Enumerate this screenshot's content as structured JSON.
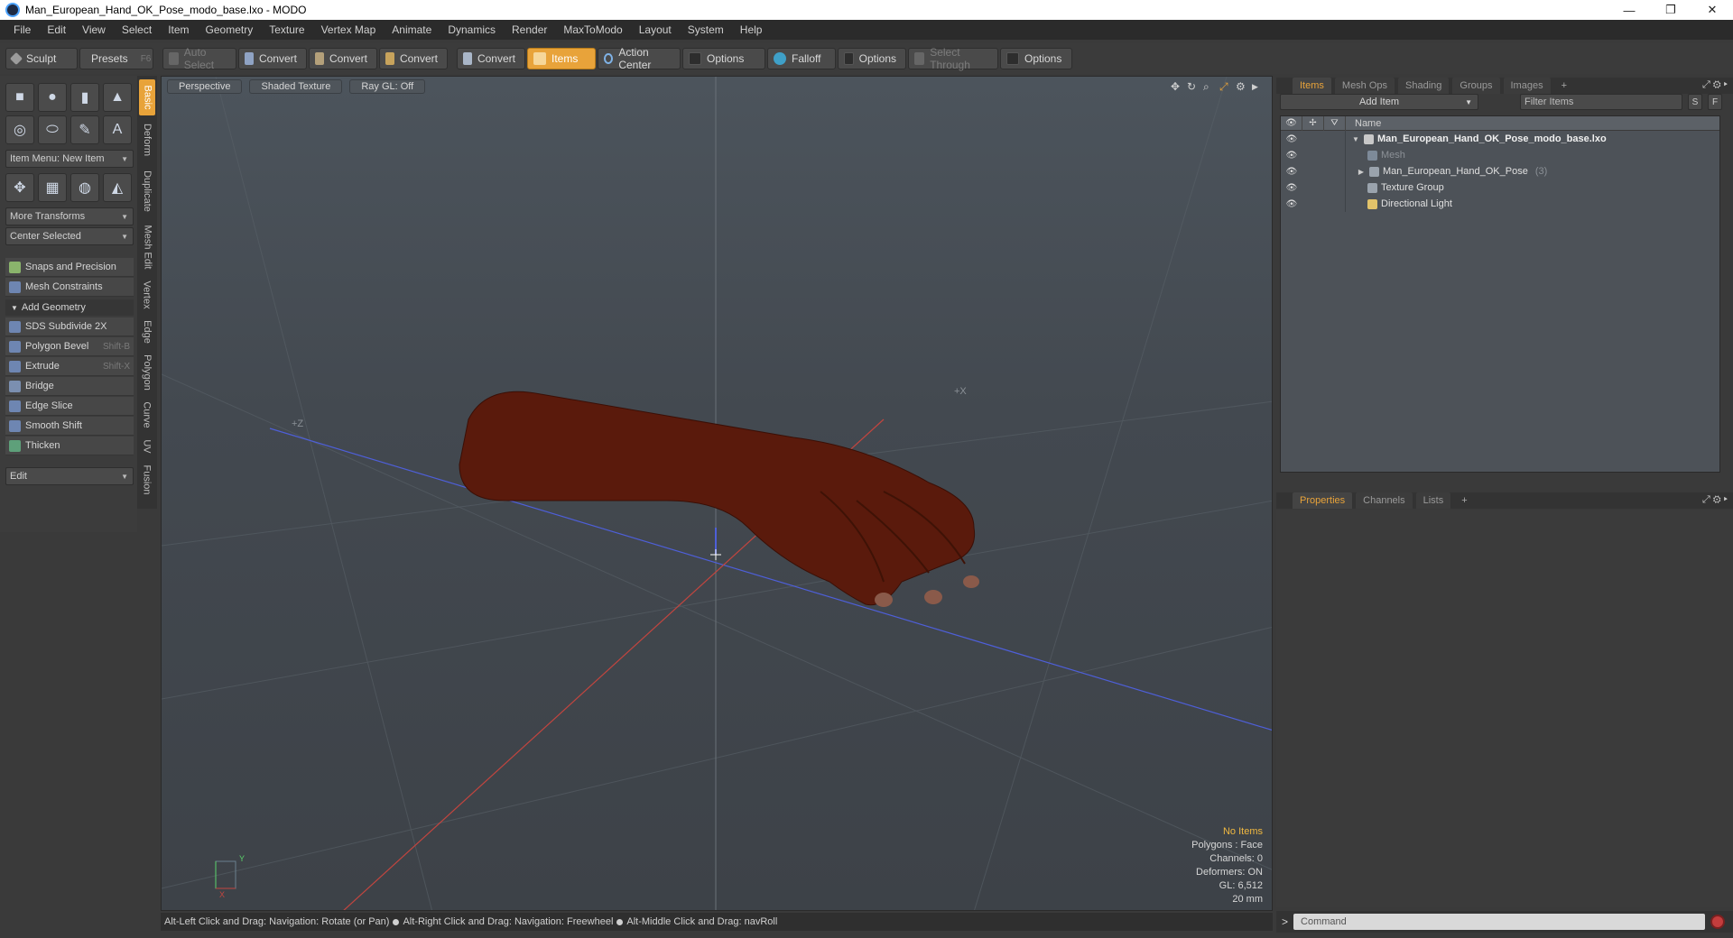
{
  "window": {
    "title": "Man_European_Hand_OK_Pose_modo_base.lxo - MODO",
    "minimize": "—",
    "maximize": "❐",
    "close": "✕"
  },
  "menubar": [
    "File",
    "Edit",
    "View",
    "Select",
    "Item",
    "Geometry",
    "Texture",
    "Vertex Map",
    "Animate",
    "Dynamics",
    "Render",
    "MaxToModo",
    "Layout",
    "System",
    "Help"
  ],
  "toolbar": {
    "sculpt": "Sculpt",
    "presets": "Presets",
    "presets_shortcut": "F6",
    "auto_select": "Auto Select",
    "convert1": "Convert",
    "convert2": "Convert",
    "convert3": "Convert",
    "convert4": "Convert",
    "items": "Items",
    "action_center": "Action Center",
    "options1": "Options",
    "falloff": "Falloff",
    "options2": "Options",
    "select_through": "Select Through",
    "options3": "Options"
  },
  "left_panel": {
    "item_menu": "Item Menu: New Item",
    "more_transforms": "More Transforms",
    "center_selected": "Center Selected",
    "snaps": "Snaps and Precision",
    "mesh_constraints": "Mesh Constraints",
    "add_geometry": "Add Geometry",
    "tools": [
      {
        "label": "SDS Subdivide 2X",
        "shortcut": ""
      },
      {
        "label": "Polygon Bevel",
        "shortcut": "Shift-B"
      },
      {
        "label": "Extrude",
        "shortcut": "Shift-X"
      },
      {
        "label": "Bridge",
        "shortcut": ""
      },
      {
        "label": "Edge Slice",
        "shortcut": ""
      },
      {
        "label": "Smooth Shift",
        "shortcut": ""
      },
      {
        "label": "Thicken",
        "shortcut": ""
      }
    ],
    "edit_dropdown": "Edit",
    "vertical_tabs": [
      "Basic",
      "Deform",
      "Duplicate",
      "Mesh Edit",
      "Vertex",
      "Edge",
      "Polygon",
      "Curve",
      "UV",
      "Fusion"
    ]
  },
  "viewport": {
    "view": "Perspective",
    "shading": "Shaded Texture",
    "raygl": "Ray GL: Off",
    "axis_z": "+Z",
    "axis_x": "+X",
    "stats": {
      "selection": "No Items",
      "polygons": "Polygons : Face",
      "channels": "Channels: 0",
      "deformers": "Deformers: ON",
      "gl": "GL: 6,512",
      "unit": "20 mm"
    }
  },
  "statusbar": {
    "hint1": "Alt-Left Click and Drag: Navigation: Rotate (or Pan)",
    "hint2": "Alt-Right Click and Drag: Navigation: Freewheel",
    "hint3": "Alt-Middle Click and Drag: navRoll"
  },
  "items_panel": {
    "tabs": [
      "Items",
      "Mesh Ops",
      "Shading",
      "Groups",
      "Images"
    ],
    "add_item": "Add Item",
    "filter_placeholder": "Filter Items",
    "btn_s": "S",
    "btn_f": "F",
    "name_header": "Name",
    "rows": [
      {
        "label": "Man_European_Hand_OK_Pose_modo_base.lxo",
        "count": ""
      },
      {
        "label": "Mesh",
        "count": ""
      },
      {
        "label": "Man_European_Hand_OK_Pose",
        "count": "(3)"
      },
      {
        "label": "Texture Group",
        "count": ""
      },
      {
        "label": "Directional Light",
        "count": ""
      }
    ]
  },
  "properties_panel": {
    "tabs": [
      "Properties",
      "Channels",
      "Lists"
    ]
  },
  "command": {
    "placeholder": "Command",
    "prompt": ">"
  }
}
